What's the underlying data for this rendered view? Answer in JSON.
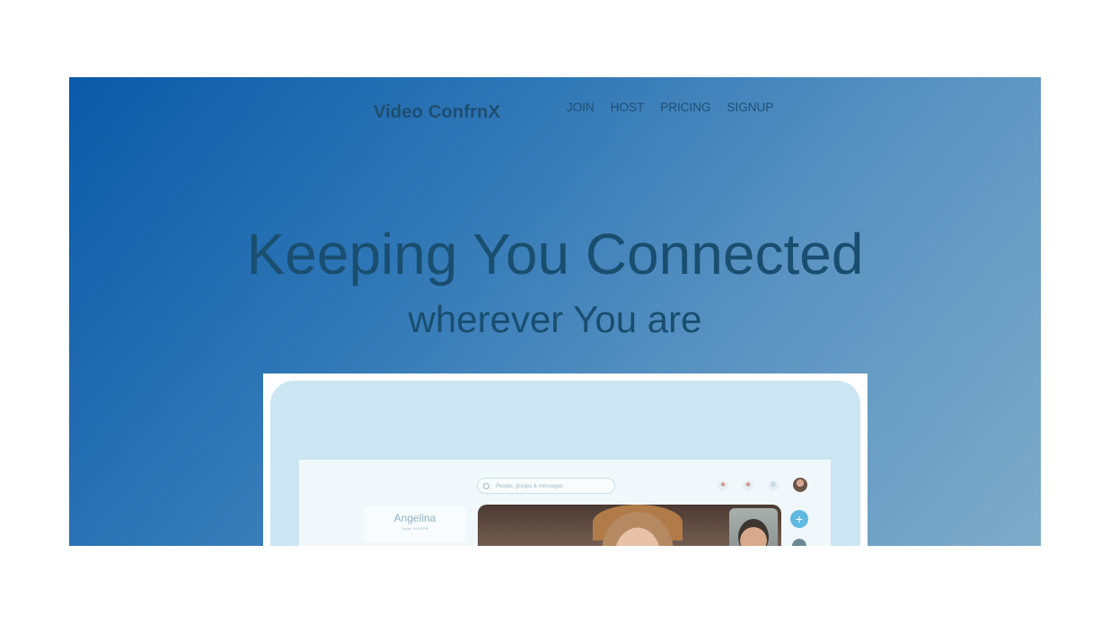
{
  "header": {
    "brand": "Video ConfrnX",
    "nav": [
      "JOIN",
      "HOST",
      "PRICING",
      "SIGNUP"
    ]
  },
  "hero": {
    "headline": "Keeping You Connected",
    "subheadline": "wherever You are"
  },
  "preview": {
    "search_placeholder": "People, groups & messages",
    "contact_name": "Angelina",
    "contact_time": "Today, 04:00 PM",
    "fab_symbol": "+"
  },
  "colors": {
    "gradient_start": "#0b5aa8",
    "gradient_end": "#7eabc8",
    "text_dark": "#1a4e6f",
    "accent": "#5fb9e0"
  }
}
